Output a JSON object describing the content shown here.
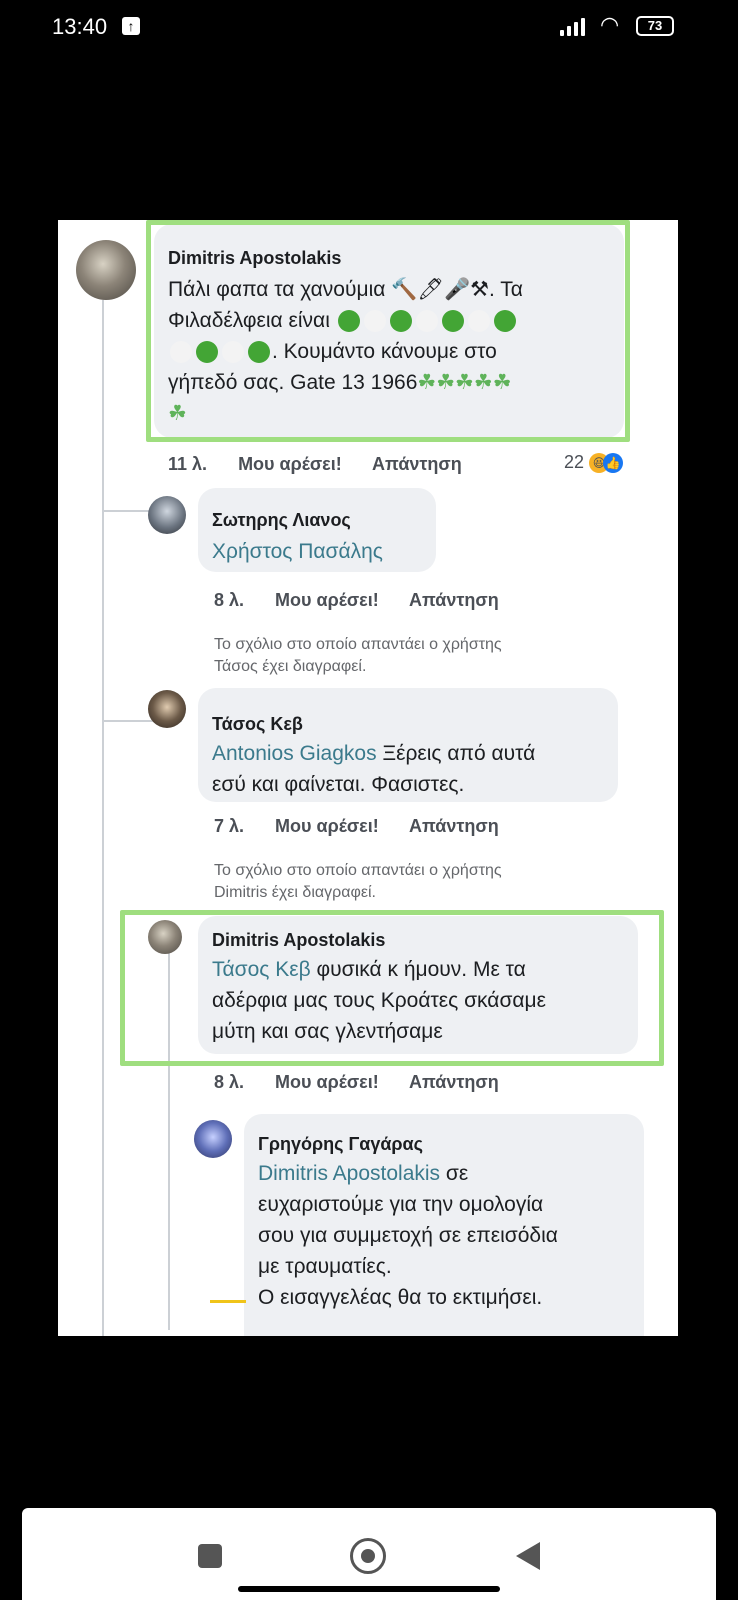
{
  "status_bar": {
    "time": "13:40",
    "battery": "73"
  },
  "comments": [
    {
      "author": "Dimitris Apostolakis",
      "line1_prefix": "Πάλι φαπα τα χανούμια ",
      "tools": "🔨🖊🎤⚒",
      "line1_suffix": ". Τα",
      "line2": "Φιλαδέλφεια είναι",
      "line3": ". Κουμάντο κάνουμε στο",
      "line4": "γήπεδό σας. Gate 13 1966",
      "clovers": "☘☘☘☘☘",
      "clover_last": "☘",
      "time": "11 λ.",
      "like": "Μου αρέσει!",
      "reply": "Απάντηση",
      "reactions": "22"
    },
    {
      "author": "Σωτηρης Λιανος",
      "mention": "Χρήστος Πασάλης",
      "time": "8 λ.",
      "like": "Μου αρέσει!",
      "reply": "Απάντηση"
    },
    {
      "deleted_notice": "Το σχόλιο στο οποίο απαντάει ο χρήστης",
      "deleted_notice2": "Τάσος έχει διαγραφεί."
    },
    {
      "author": "Τάσος Κεβ",
      "mention": "Antonios Giagkos",
      "text1": " Ξέρεις από αυτά",
      "text2": "εσύ και φαίνεται. Φασιστες.",
      "time": "7 λ.",
      "like": "Μου αρέσει!",
      "reply": "Απάντηση"
    },
    {
      "deleted_notice": "Το σχόλιο στο οποίο απαντάει ο χρήστης",
      "deleted_notice2": "Dimitris έχει διαγραφεί."
    },
    {
      "author": "Dimitris Apostolakis",
      "mention": "Τάσος Κεβ",
      "text1": " φυσικά κ ήμουν. Με τα",
      "text2": "αδέρφια μας τους Κροάτες σκάσαμε",
      "text3": "μύτη και σας γλεντήσαμε",
      "time": "8 λ.",
      "like": "Μου αρέσει!",
      "reply": "Απάντηση"
    },
    {
      "author": "Γρηγόρης Γαγάρας",
      "mention": "Dimitris Apostolakis",
      "text1": " σε",
      "text2": "ευχαριστούμε για την ομολογία",
      "text3": "σου για συμμετοχή σε επεισόδια",
      "text4": "με τραυματίες.",
      "text5": "Ο εισαγγελέας θα το εκτιμήσει."
    }
  ],
  "colors": {
    "highlight_frame": "#9fde7f",
    "link": "#3b7a8c",
    "bubble": "#eef0f3"
  }
}
